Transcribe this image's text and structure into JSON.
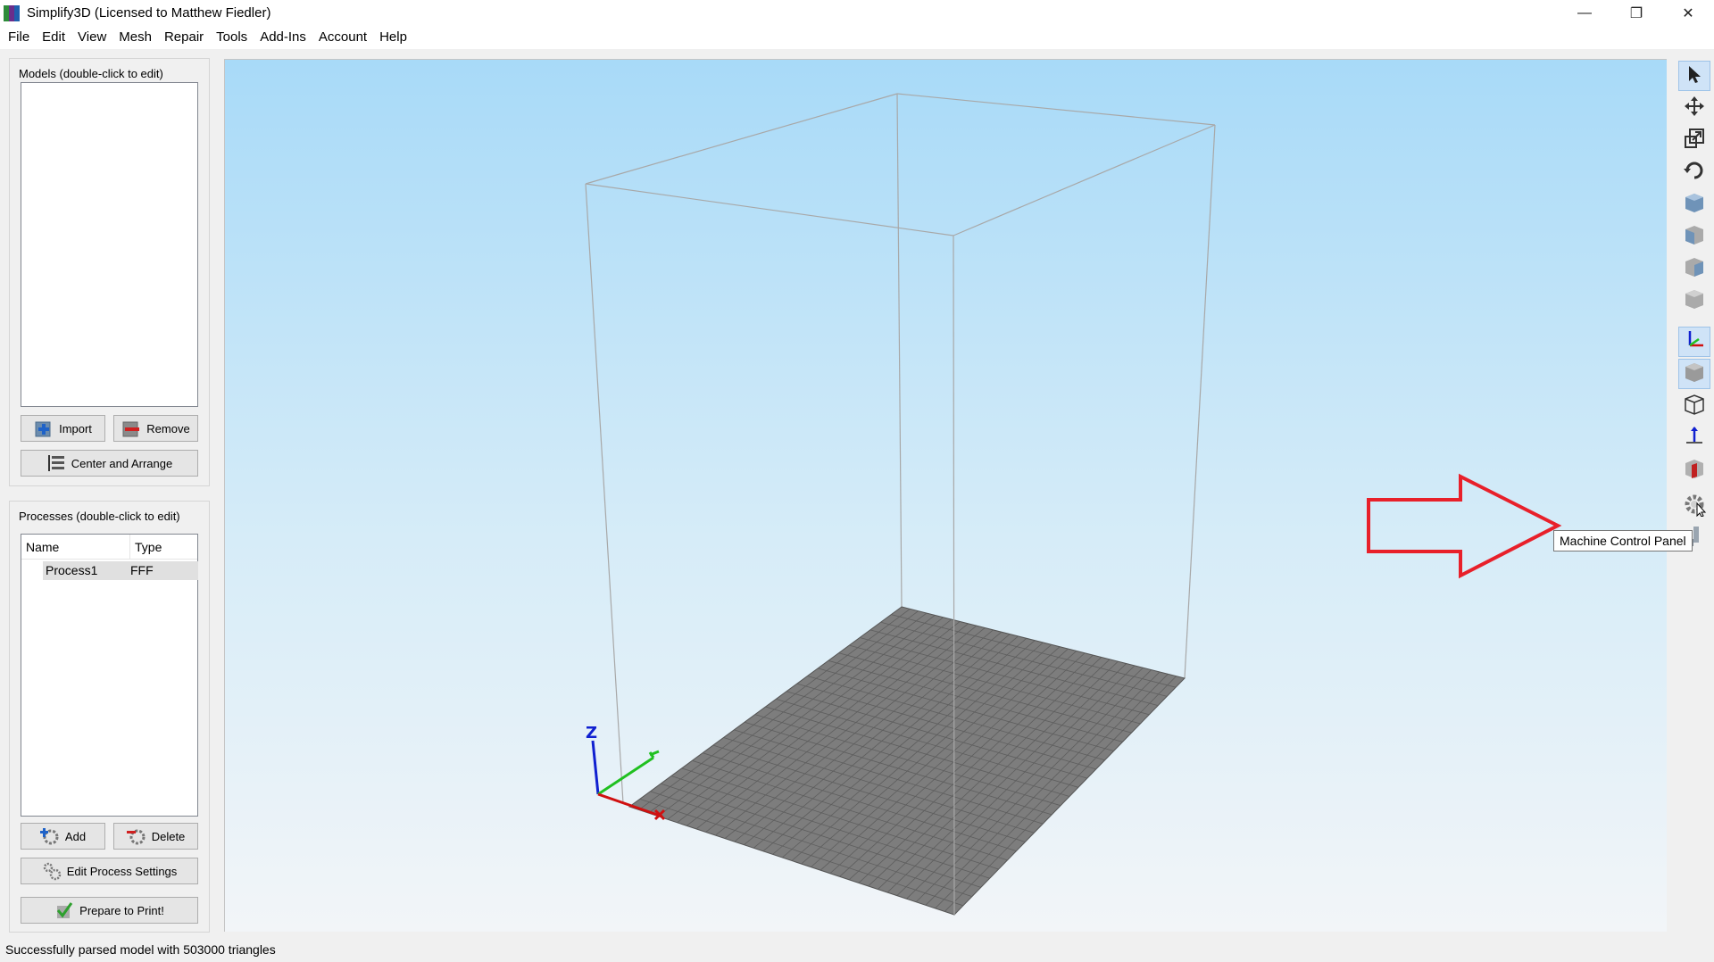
{
  "window": {
    "title": "Simplify3D (Licensed to Matthew Fiedler)",
    "minimize_glyph": "—",
    "restore_glyph": "❐",
    "close_glyph": "✕"
  },
  "menu": [
    "File",
    "Edit",
    "View",
    "Mesh",
    "Repair",
    "Tools",
    "Add-Ins",
    "Account",
    "Help"
  ],
  "models": {
    "title": "Models (double-click to edit)",
    "import_label": "Import",
    "remove_label": "Remove",
    "center_label": "Center and Arrange"
  },
  "processes": {
    "title": "Processes (double-click to edit)",
    "columns": [
      "Name",
      "Type"
    ],
    "rows": [
      {
        "name": "Process1",
        "type": "FFF"
      }
    ],
    "add_label": "Add",
    "delete_label": "Delete",
    "edit_label": "Edit Process Settings",
    "prepare_label": "Prepare to Print!"
  },
  "viewport": {
    "axis_z_label": "Z",
    "annotation_arrow_color": "#e8202a"
  },
  "toolbar": {
    "tools": [
      "select-arrow-icon",
      "move-icon",
      "scale-icon",
      "rotate-icon",
      "view-default-cube-icon",
      "view-front-cube-icon",
      "view-side-cube-icon",
      "view-top-cube-icon",
      "axes-toggle-icon",
      "solid-view-icon",
      "wireframe-view-icon",
      "z-axis-icon",
      "cross-section-icon",
      "machine-control-gear-icon",
      "tool-extra-icon"
    ],
    "tooltip": "Machine Control Panel"
  },
  "status": {
    "text": "Successfully parsed model with 503000 triangles"
  }
}
